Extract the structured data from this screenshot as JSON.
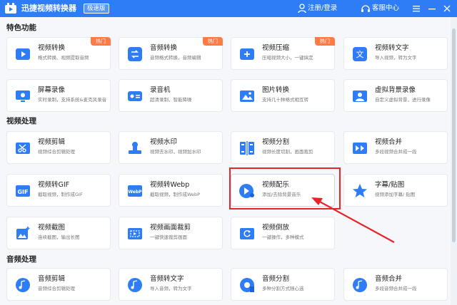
{
  "titlebar": {
    "app_name": "迅捷视频转换器",
    "edition": "极速版",
    "login": "注册/登录",
    "service": "客服中心"
  },
  "sections": {
    "featured": "特色功能",
    "video": "视频处理",
    "audio": "音频处理"
  },
  "cards": {
    "video_convert": {
      "title": "视频转换",
      "desc": "格式转换、视频提取音频",
      "badge": "热门",
      "icon": "video-convert-icon"
    },
    "audio_convert": {
      "title": "音频转换",
      "desc": "音频格式转换，音频编辑",
      "badge": "热门",
      "icon": "audio-convert-icon"
    },
    "video_compress": {
      "title": "视频压缩",
      "desc": "压缩视频大小，一键搞定",
      "badge": "热门",
      "icon": "video-compress-icon"
    },
    "video_to_text": {
      "title": "视频转文字",
      "desc": "导入视频，转为文字",
      "icon": "video-to-text-icon"
    },
    "screen_record": {
      "title": "屏幕录像",
      "desc": "实时录制，支持系统&麦克风录音",
      "icon": "screen-record-icon"
    },
    "audio_record": {
      "title": "录音机",
      "desc": "超清录制，智能降噪",
      "icon": "recorder-icon"
    },
    "image_convert": {
      "title": "图片转换",
      "desc": "支持几十种格式相互转",
      "icon": "image-convert-icon"
    },
    "virtual_bg": {
      "title": "虚拟背景录像",
      "desc": "自定义虚拟背景，进行录像",
      "icon": "virtual-bg-icon"
    },
    "video_edit": {
      "title": "视频剪辑",
      "desc": "视频综合剪辑处理",
      "icon": "video-edit-icon"
    },
    "video_watermark": {
      "title": "视频水印",
      "desc": "视频去水印，视频加水印",
      "icon": "video-watermark-icon"
    },
    "video_split": {
      "title": "视频分割",
      "desc": "视频长度切割，画面裁剪",
      "icon": "video-split-icon"
    },
    "video_merge": {
      "title": "视频合并",
      "desc": "多段视频合并成一段",
      "icon": "video-merge-icon"
    },
    "video_gif": {
      "title": "视频转GIF",
      "desc": "截取视频，制作成GIF",
      "icon": "gif-icon"
    },
    "video_webp": {
      "title": "视频转Webp",
      "desc": "截取视频，制作成WebP",
      "icon": "webp-icon"
    },
    "video_music": {
      "title": "视频配乐",
      "desc": "添加/去除背景音乐",
      "icon": "video-music-icon"
    },
    "subtitle": {
      "title": "字幕/贴图",
      "desc": "视频添加字幕/ 贴图",
      "icon": "subtitle-icon"
    },
    "video_screenshot": {
      "title": "视频截图",
      "desc": "连续截图，输出长图",
      "icon": "video-screenshot-icon"
    },
    "video_crop": {
      "title": "视频画面裁剪",
      "desc": "一键快速裁剪画面",
      "icon": "video-crop-icon"
    },
    "video_reverse": {
      "title": "视频倒放",
      "desc": "一键操作，多种模式",
      "icon": "video-reverse-icon"
    },
    "audio_edit": {
      "title": "音频剪辑",
      "desc": "音频综合剪辑处理",
      "icon": "audio-edit-icon"
    },
    "audio_to_text": {
      "title": "音频转文字",
      "desc": "导入音频，转为文字",
      "icon": "audio-to-text-icon"
    },
    "audio_split": {
      "title": "音频分割",
      "desc": "多种分割方式随心选",
      "icon": "audio-split-icon"
    },
    "audio_merge": {
      "title": "音频合并",
      "desc": "多段音频合并成一段",
      "icon": "audio-merge-icon"
    }
  },
  "colors": {
    "primary": "#2f7df6",
    "hot_badge": "#ff7a45",
    "annotation": "#e8242b"
  }
}
